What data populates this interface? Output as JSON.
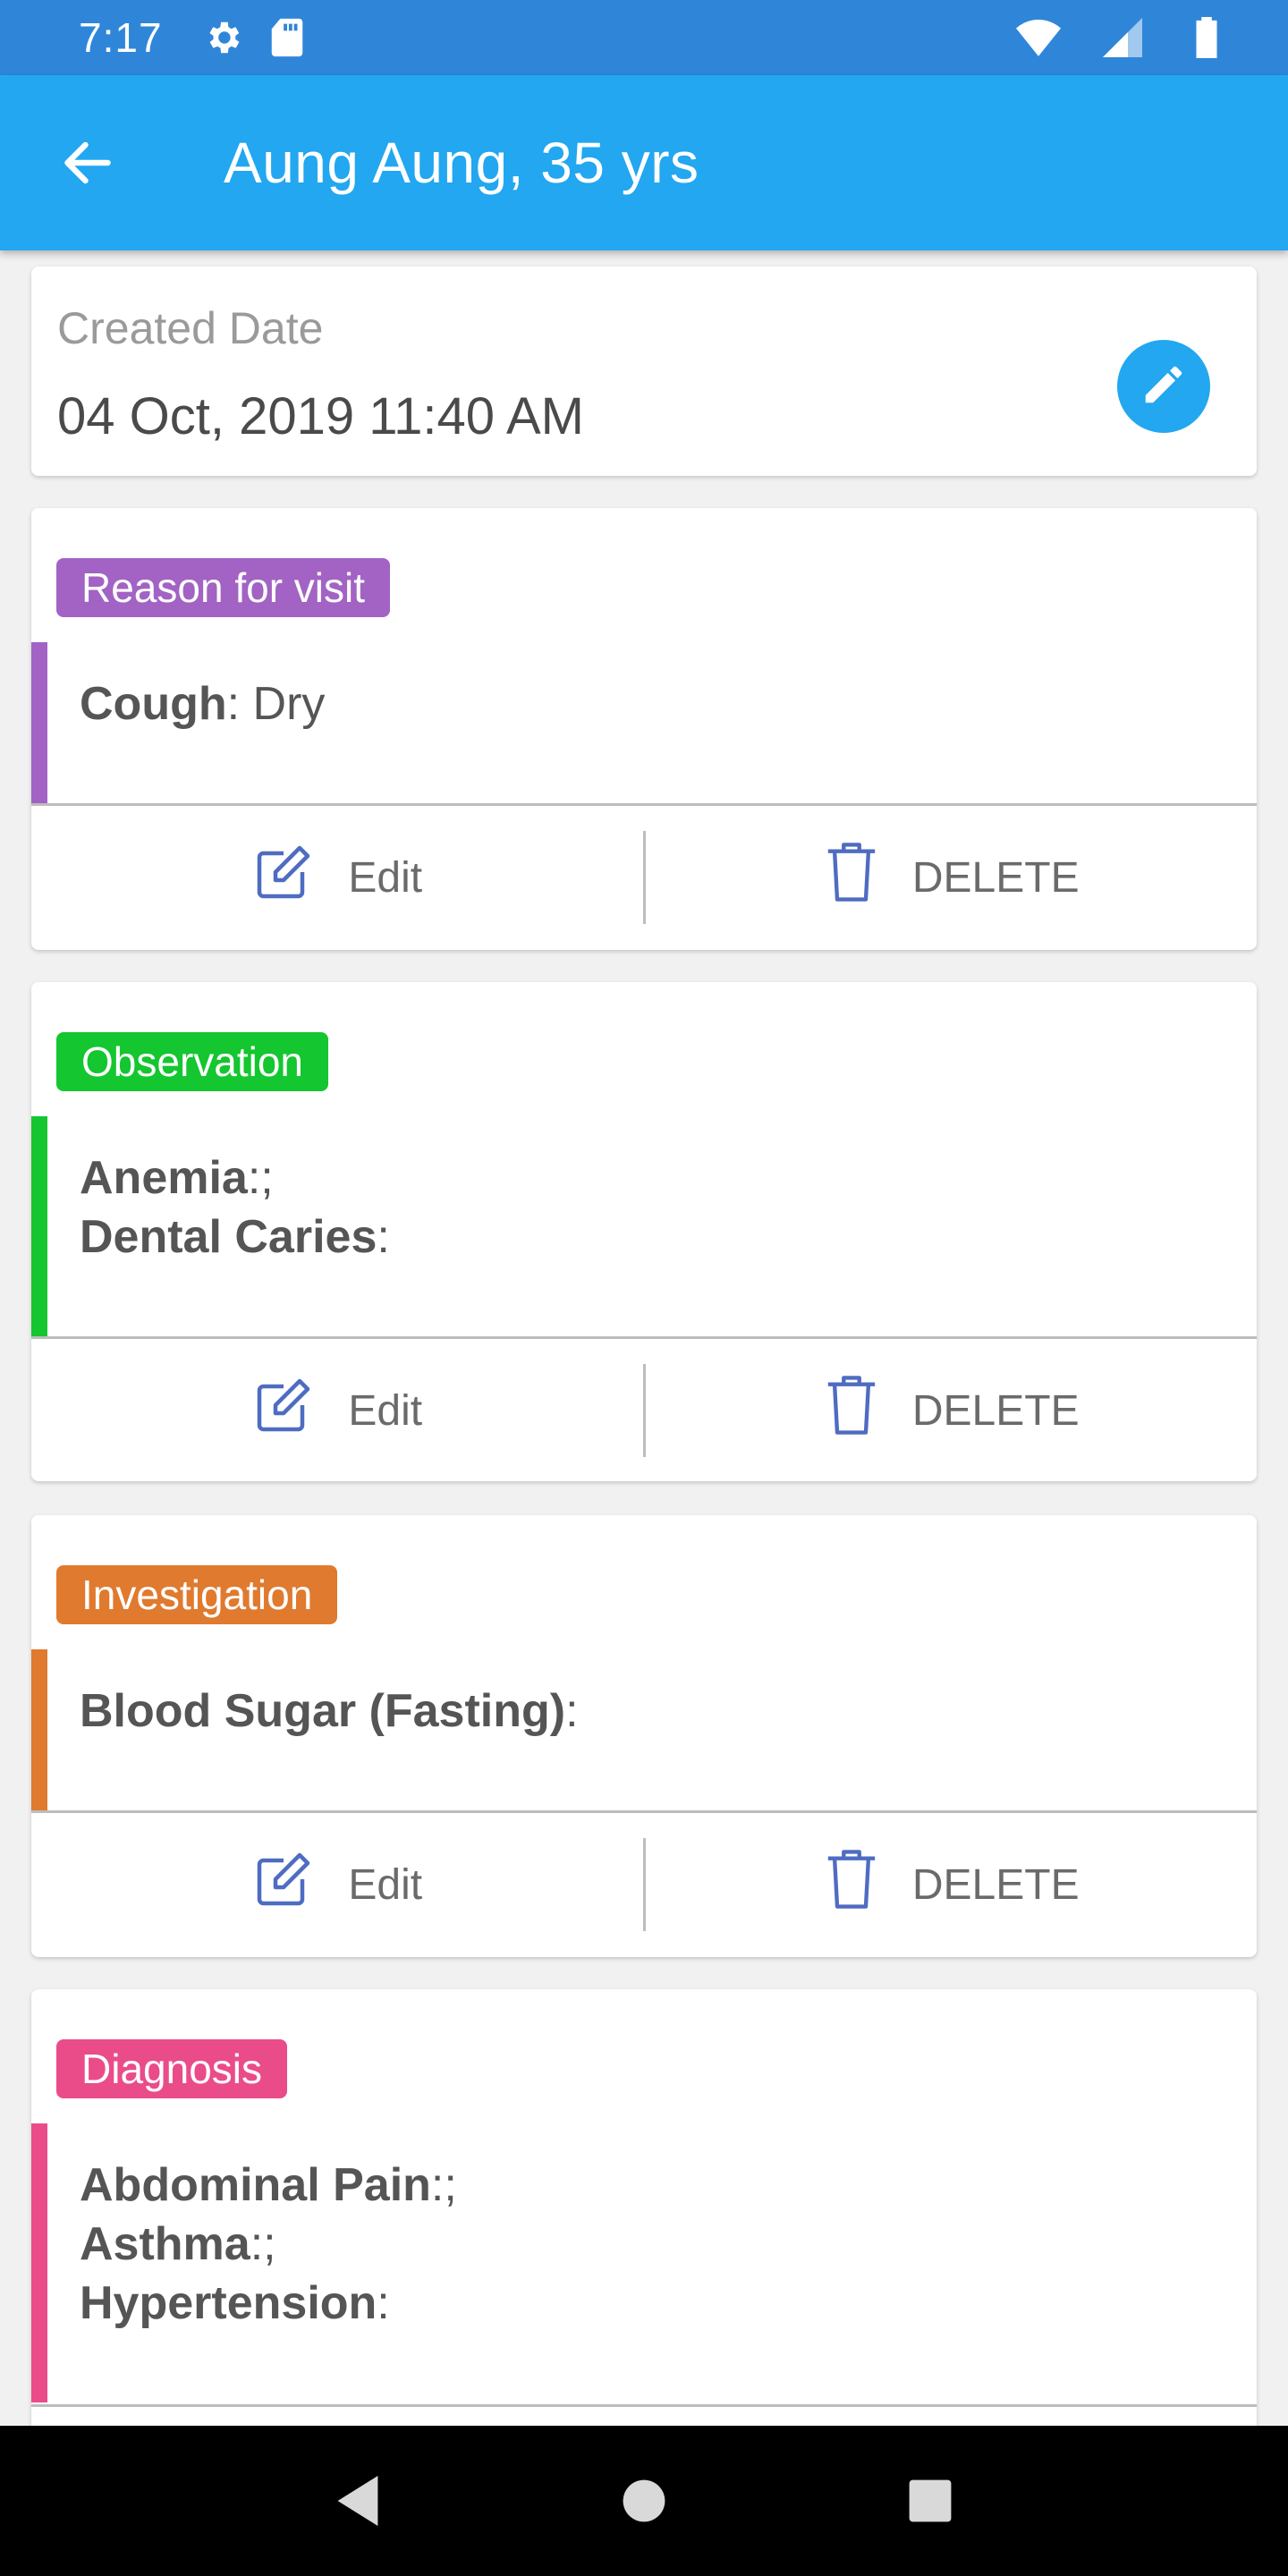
{
  "status_bar": {
    "time": "7:17"
  },
  "app_bar": {
    "title": "Aung Aung, 35 yrs"
  },
  "record": {
    "created_label": "Created Date",
    "created_value": "04 Oct, 2019 11:40 AM"
  },
  "actions": {
    "edit_label": "Edit",
    "delete_label": "DELETE"
  },
  "sections": [
    {
      "tag": "Reason for visit",
      "color": "#a263c4",
      "entries": [
        {
          "name": "Cough",
          "sep": ": ",
          "value": "Dry"
        }
      ]
    },
    {
      "tag": "Observation",
      "color": "#14c62f",
      "entries": [
        {
          "name": "Anemia",
          "sep": ":;",
          "value": ""
        },
        {
          "name": "Dental Caries",
          "sep": ":",
          "value": ""
        }
      ]
    },
    {
      "tag": "Investigation",
      "color": "#e07a2f",
      "entries": [
        {
          "name": "Blood Sugar (Fasting)",
          "sep": ":",
          "value": ""
        }
      ]
    },
    {
      "tag": "Diagnosis",
      "color": "#ea4c8a",
      "entries": [
        {
          "name": "Abdominal Pain",
          "sep": ":;",
          "value": ""
        },
        {
          "name": "Asthma",
          "sep": ":;",
          "value": ""
        },
        {
          "name": "Hypertension",
          "sep": ":",
          "value": ""
        }
      ]
    }
  ],
  "colors": {
    "primary": "#22a7f0",
    "status_bar": "#2f86d9",
    "icon_blue": "#4e6cc1"
  }
}
